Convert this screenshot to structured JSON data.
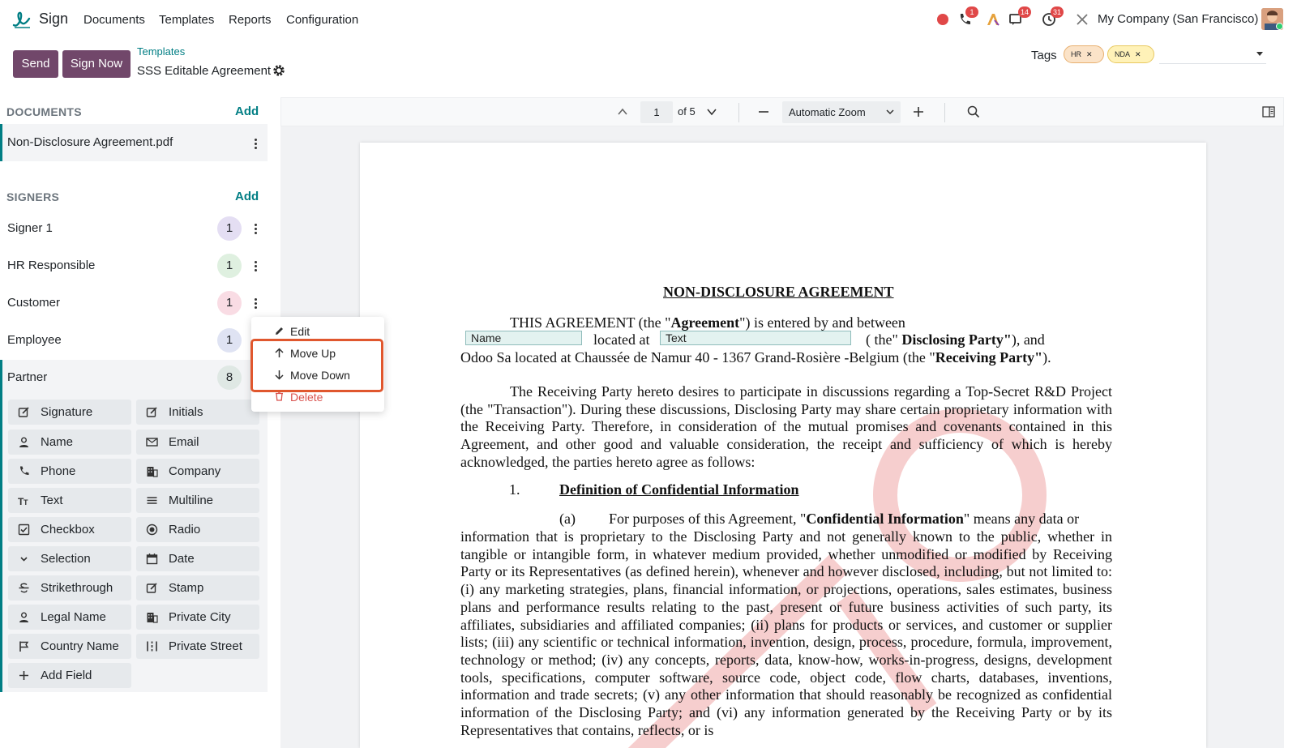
{
  "topnav": {
    "app_name": "Sign",
    "menu": [
      "Documents",
      "Templates",
      "Reports",
      "Configuration"
    ],
    "badges": {
      "calls": "1",
      "messages": "14",
      "activities": "31"
    },
    "company": "My Company (San Francisco)"
  },
  "control": {
    "send_label": "Send",
    "sign_now_label": "Sign Now",
    "breadcrumb_parent": "Templates",
    "breadcrumb_current": "SSS Editable Agreement",
    "tags_label": "Tags",
    "tags": [
      "HR",
      "NDA"
    ]
  },
  "documents": {
    "header": "DOCUMENTS",
    "add_label": "Add",
    "items": [
      "Non-Disclosure Agreement.pdf"
    ]
  },
  "signers": {
    "header": "SIGNERS",
    "add_label": "Add",
    "items": [
      {
        "name": "Signer 1",
        "count": "1",
        "color": "#e4def3"
      },
      {
        "name": "HR Responsible",
        "count": "1",
        "color": "#dff0e0"
      },
      {
        "name": "Customer",
        "count": "1",
        "color": "#f9dce4"
      },
      {
        "name": "Employee",
        "count": "1",
        "color": "#dfe3f3"
      },
      {
        "name": "Partner",
        "count": "8",
        "color": "#dfe8e4"
      }
    ]
  },
  "context_menu": {
    "edit": "Edit",
    "move_up": "Move Up",
    "move_down": "Move Down",
    "delete": "Delete"
  },
  "fields": [
    "Signature",
    "Initials",
    "Name",
    "Email",
    "Phone",
    "Company",
    "Text",
    "Multiline",
    "Checkbox",
    "Radio",
    "Selection",
    "Date",
    "Strikethrough",
    "Stamp",
    "Legal Name",
    "Private City",
    "Country Name",
    "Private Street",
    "Add Field"
  ],
  "viewer": {
    "page": "1",
    "of_pages": "of 5",
    "zoom": "Automatic Zoom"
  },
  "doc": {
    "title": "NON-DISCLOSURE AGREEMENT",
    "line1_a": "THIS AGREEMENT (the \"",
    "line1_b": "Agreement",
    "line1_c": "\") is entered by and between",
    "field_name": "Name",
    "located_at": "located at",
    "field_text": "Text",
    "line2_a": "( the\" ",
    "line2_b": "Disclosing Party\"",
    "line2_c": "), and",
    "line3_a": "Odoo Sa located at Chaussée de Namur 40 - 1367 Grand-Rosière  -Belgium (the \"",
    "line3_b": "Receiving Party\"",
    "line3_c": ").",
    "para1": "The Receiving Party hereto desires to participate in discussions regarding a Top-Secret R&D Project (the \"Transaction\").  During these discussions, Disclosing Party may share certain proprietary information with the Receiving Party.  Therefore, in consideration of the mutual promises and covenants contained in this Agreement, and other good and valuable consideration, the receipt and sufficiency of which is hereby acknowledged, the parties hereto agree as follows:",
    "section_num": "1.",
    "section_title": "Definition of Confidential Information",
    "item_a": "(a)",
    "item_a_lead": "For purposes of this Agreement, \"",
    "item_a_bold": "Confidential Information",
    "item_a_tail": "\" means any data or",
    "para2": "information that is proprietary to the Disclosing Party and not generally known to the public, whether in tangible or intangible form, in whatever medium provided, whether unmodified or modified by Receiving Party or its Representatives (as defined herein), whenever and however disclosed, including, but not limited to: (i) any marketing strategies, plans, financial information, or projections, operations, sales estimates, business plans and performance results relating to the past, present or future business activities of such party, its affiliates, subsidiaries and affiliated companies; (ii) plans for products or services, and customer or supplier lists; (iii) any scientific or technical information, invention, design, process, procedure, formula, improvement, technology or method; (iv) any concepts, reports, data, know-how, works-in-progress, designs, development tools, specifications, computer software, source code, object code, flow charts, databases, inventions, information and trade secrets; (v) any other information that should reasonably be recognized as confidential information of the Disclosing Party; and (vi) any information generated by the Receiving Party or by its Representatives that contains, reflects, or is"
  }
}
